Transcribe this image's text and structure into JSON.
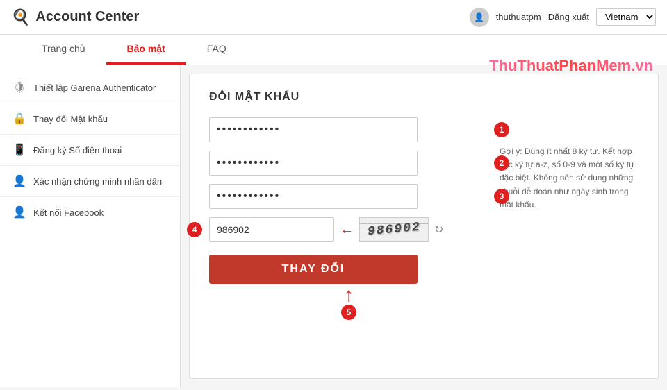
{
  "header": {
    "title": "Account Center",
    "logo_alt": "Garena logo",
    "username": "thuthuatpm",
    "logout_label": "Đăng xuất",
    "country": "Vietnam"
  },
  "nav": {
    "tabs": [
      {
        "label": "Trang chủ",
        "active": false
      },
      {
        "label": "Bảo mật",
        "active": true
      },
      {
        "label": "FAQ",
        "active": false
      }
    ]
  },
  "watermark": "ThuThuatPhanMem.vn",
  "sidebar": {
    "items": [
      {
        "label": "Thiết lập Garena Authenticator",
        "icon": "shield"
      },
      {
        "label": "Thay đổi Mật khẩu",
        "icon": "lock"
      },
      {
        "label": "Đăng ký Số điện thoại",
        "icon": "phone"
      },
      {
        "label": "Xác nhận chứng minh nhân dân",
        "icon": "id"
      },
      {
        "label": "Kết nối Facebook",
        "icon": "facebook"
      }
    ]
  },
  "form": {
    "title": "ĐỔI MẬT KHẨU",
    "field1": {
      "value": "••••••••••••",
      "placeholder": ""
    },
    "field2": {
      "value": "••••••••••••",
      "placeholder": ""
    },
    "field3": {
      "value": "••••••••••••",
      "placeholder": ""
    },
    "captcha_input_value": "986902",
    "captcha_text": "986902",
    "submit_label": "THAY ĐỔI",
    "hint": "Gợi ý: Dùng ít nhất 8 ký tự. Kết hợp các ký tự a-z, số 0-9 và một số ký tự đặc biệt. Không nên sử dụng những chuỗi dễ đoán như ngày sinh trong mật khẩu.",
    "steps": [
      "1",
      "2",
      "3",
      "4",
      "5"
    ]
  }
}
